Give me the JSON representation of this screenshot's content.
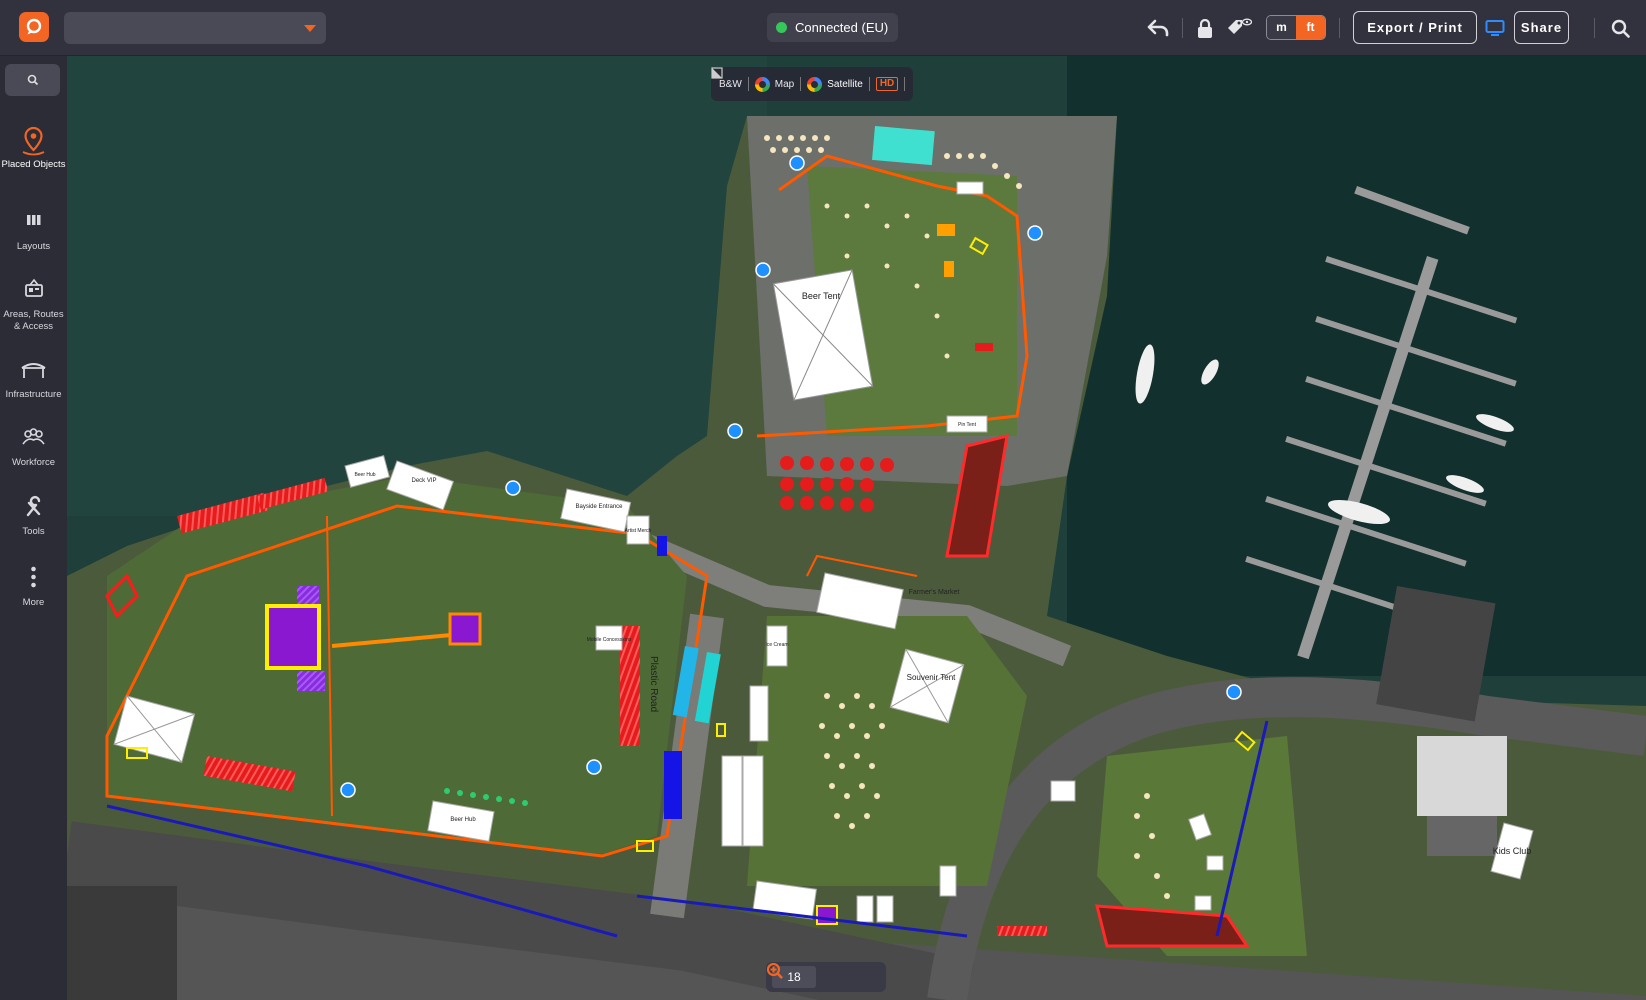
{
  "header": {
    "connection_status": "Connected (EU)",
    "units": {
      "metric": "m",
      "imperial": "ft",
      "active": "ft"
    },
    "export_label": "Export / Print",
    "share_label": "Share",
    "accent_color": "#f26522"
  },
  "sidebar": {
    "items": [
      {
        "label": "Placed Objects",
        "icon": "map-pin-icon"
      },
      {
        "label": "Layouts",
        "icon": "layouts-icon"
      },
      {
        "label": "Areas, Routes & Access",
        "icon": "areas-icon"
      },
      {
        "label": "Infrastructure",
        "icon": "infrastructure-icon"
      },
      {
        "label": "Workforce",
        "icon": "workforce-icon"
      },
      {
        "label": "Tools",
        "icon": "tools-icon"
      },
      {
        "label": "More",
        "icon": "more-icon"
      }
    ]
  },
  "map_layers": {
    "bw": "B&W",
    "map": "Map",
    "satellite": "Satellite",
    "hd": "HD"
  },
  "zoom": {
    "level": "18"
  },
  "map_labels": {
    "beer_tent": "Beer Tent",
    "farmers_market": "Farmer's Market",
    "souvenir_tent": "Souvenir Tent",
    "kids_club": "Kids Club",
    "plastic_road": "Plastic Road",
    "bayside_entrance": "Bayside Entrance",
    "artist_merch": "Artist Merch",
    "deck_vip": "Deck VIP",
    "beer_hub_1": "Beer Hub",
    "beer_hub_2": "Beer Hub",
    "mobile_concessions": "Mobile Concessions",
    "ice_cream": "Ice Cream",
    "pin_tent": "Pin Tent"
  }
}
